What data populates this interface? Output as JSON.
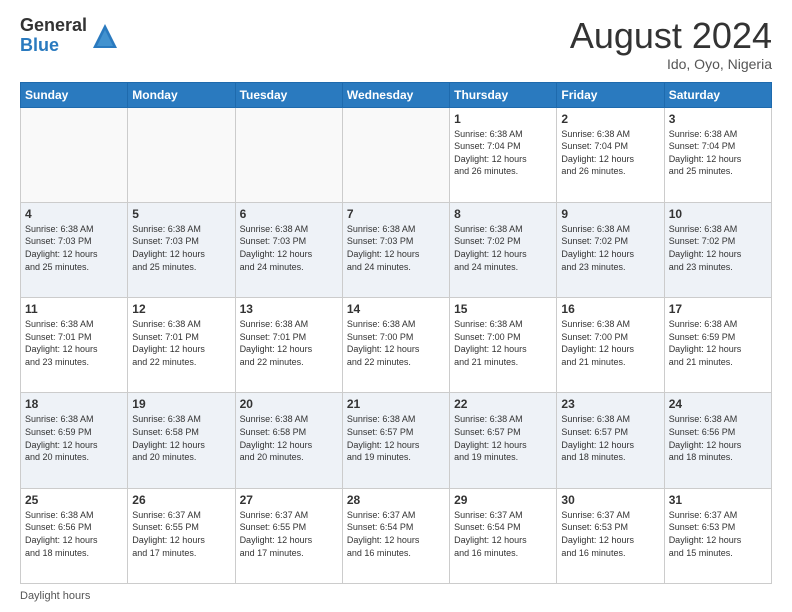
{
  "logo": {
    "general": "General",
    "blue": "Blue"
  },
  "title": "August 2024",
  "subtitle": "Ido, Oyo, Nigeria",
  "days": [
    "Sunday",
    "Monday",
    "Tuesday",
    "Wednesday",
    "Thursday",
    "Friday",
    "Saturday"
  ],
  "footer": "Daylight hours",
  "weeks": [
    [
      {
        "num": "",
        "info": ""
      },
      {
        "num": "",
        "info": ""
      },
      {
        "num": "",
        "info": ""
      },
      {
        "num": "",
        "info": ""
      },
      {
        "num": "1",
        "info": "Sunrise: 6:38 AM\nSunset: 7:04 PM\nDaylight: 12 hours\nand 26 minutes."
      },
      {
        "num": "2",
        "info": "Sunrise: 6:38 AM\nSunset: 7:04 PM\nDaylight: 12 hours\nand 26 minutes."
      },
      {
        "num": "3",
        "info": "Sunrise: 6:38 AM\nSunset: 7:04 PM\nDaylight: 12 hours\nand 25 minutes."
      }
    ],
    [
      {
        "num": "4",
        "info": "Sunrise: 6:38 AM\nSunset: 7:03 PM\nDaylight: 12 hours\nand 25 minutes."
      },
      {
        "num": "5",
        "info": "Sunrise: 6:38 AM\nSunset: 7:03 PM\nDaylight: 12 hours\nand 25 minutes."
      },
      {
        "num": "6",
        "info": "Sunrise: 6:38 AM\nSunset: 7:03 PM\nDaylight: 12 hours\nand 24 minutes."
      },
      {
        "num": "7",
        "info": "Sunrise: 6:38 AM\nSunset: 7:03 PM\nDaylight: 12 hours\nand 24 minutes."
      },
      {
        "num": "8",
        "info": "Sunrise: 6:38 AM\nSunset: 7:02 PM\nDaylight: 12 hours\nand 24 minutes."
      },
      {
        "num": "9",
        "info": "Sunrise: 6:38 AM\nSunset: 7:02 PM\nDaylight: 12 hours\nand 23 minutes."
      },
      {
        "num": "10",
        "info": "Sunrise: 6:38 AM\nSunset: 7:02 PM\nDaylight: 12 hours\nand 23 minutes."
      }
    ],
    [
      {
        "num": "11",
        "info": "Sunrise: 6:38 AM\nSunset: 7:01 PM\nDaylight: 12 hours\nand 23 minutes."
      },
      {
        "num": "12",
        "info": "Sunrise: 6:38 AM\nSunset: 7:01 PM\nDaylight: 12 hours\nand 22 minutes."
      },
      {
        "num": "13",
        "info": "Sunrise: 6:38 AM\nSunset: 7:01 PM\nDaylight: 12 hours\nand 22 minutes."
      },
      {
        "num": "14",
        "info": "Sunrise: 6:38 AM\nSunset: 7:00 PM\nDaylight: 12 hours\nand 22 minutes."
      },
      {
        "num": "15",
        "info": "Sunrise: 6:38 AM\nSunset: 7:00 PM\nDaylight: 12 hours\nand 21 minutes."
      },
      {
        "num": "16",
        "info": "Sunrise: 6:38 AM\nSunset: 7:00 PM\nDaylight: 12 hours\nand 21 minutes."
      },
      {
        "num": "17",
        "info": "Sunrise: 6:38 AM\nSunset: 6:59 PM\nDaylight: 12 hours\nand 21 minutes."
      }
    ],
    [
      {
        "num": "18",
        "info": "Sunrise: 6:38 AM\nSunset: 6:59 PM\nDaylight: 12 hours\nand 20 minutes."
      },
      {
        "num": "19",
        "info": "Sunrise: 6:38 AM\nSunset: 6:58 PM\nDaylight: 12 hours\nand 20 minutes."
      },
      {
        "num": "20",
        "info": "Sunrise: 6:38 AM\nSunset: 6:58 PM\nDaylight: 12 hours\nand 20 minutes."
      },
      {
        "num": "21",
        "info": "Sunrise: 6:38 AM\nSunset: 6:57 PM\nDaylight: 12 hours\nand 19 minutes."
      },
      {
        "num": "22",
        "info": "Sunrise: 6:38 AM\nSunset: 6:57 PM\nDaylight: 12 hours\nand 19 minutes."
      },
      {
        "num": "23",
        "info": "Sunrise: 6:38 AM\nSunset: 6:57 PM\nDaylight: 12 hours\nand 18 minutes."
      },
      {
        "num": "24",
        "info": "Sunrise: 6:38 AM\nSunset: 6:56 PM\nDaylight: 12 hours\nand 18 minutes."
      }
    ],
    [
      {
        "num": "25",
        "info": "Sunrise: 6:38 AM\nSunset: 6:56 PM\nDaylight: 12 hours\nand 18 minutes."
      },
      {
        "num": "26",
        "info": "Sunrise: 6:37 AM\nSunset: 6:55 PM\nDaylight: 12 hours\nand 17 minutes."
      },
      {
        "num": "27",
        "info": "Sunrise: 6:37 AM\nSunset: 6:55 PM\nDaylight: 12 hours\nand 17 minutes."
      },
      {
        "num": "28",
        "info": "Sunrise: 6:37 AM\nSunset: 6:54 PM\nDaylight: 12 hours\nand 16 minutes."
      },
      {
        "num": "29",
        "info": "Sunrise: 6:37 AM\nSunset: 6:54 PM\nDaylight: 12 hours\nand 16 minutes."
      },
      {
        "num": "30",
        "info": "Sunrise: 6:37 AM\nSunset: 6:53 PM\nDaylight: 12 hours\nand 16 minutes."
      },
      {
        "num": "31",
        "info": "Sunrise: 6:37 AM\nSunset: 6:53 PM\nDaylight: 12 hours\nand 15 minutes."
      }
    ]
  ]
}
